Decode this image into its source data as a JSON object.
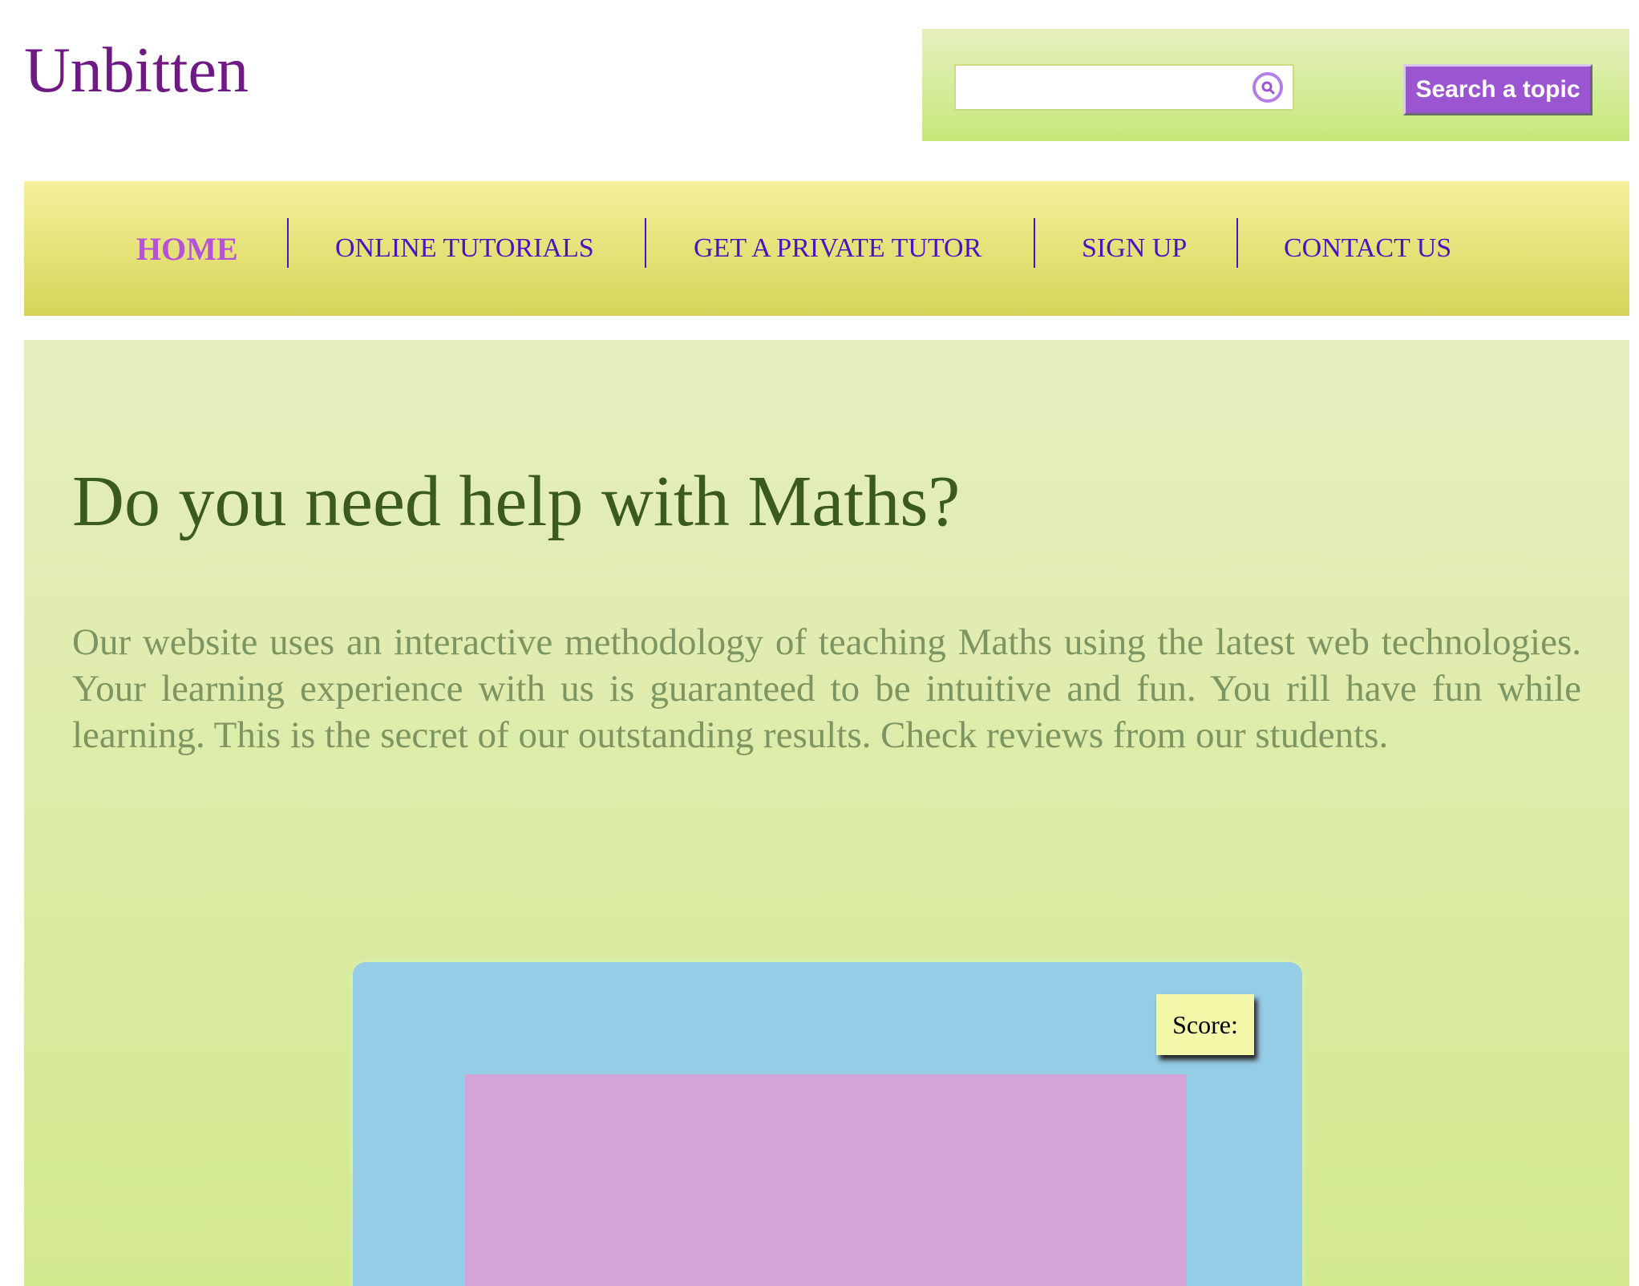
{
  "site": {
    "logo": "Unbitten"
  },
  "search": {
    "value": "",
    "placeholder": "",
    "button_label": "Search a topic"
  },
  "nav": {
    "items": [
      {
        "label": "HOME",
        "active": true
      },
      {
        "label": "ONLINE TUTORIALS",
        "active": false
      },
      {
        "label": "GET A PRIVATE TUTOR",
        "active": false
      },
      {
        "label": "SIGN UP",
        "active": false
      },
      {
        "label": "CONTACT US",
        "active": false
      }
    ]
  },
  "main": {
    "headline": "Do you need help with Maths?",
    "intro": "Our website uses an interactive methodology of teaching Maths using the latest web technologies. Your learning experience with us is guaranteed to be intuitive and fun. You rill have fun while learning. This is the secret of our outstanding results. Check reviews from our students."
  },
  "game": {
    "score_label": "Score:"
  },
  "colors": {
    "logo": "#6f1a84",
    "nav_link": "#4b14c3",
    "nav_active": "#b553d8",
    "search_button": "#9b55d0",
    "headline": "#3b5a1d",
    "intro_text": "#7d9560",
    "game_panel": "#95cce6",
    "game_area": "#d3a4d8",
    "score_box": "#f3f7a8"
  },
  "icons": {
    "search": "search-icon"
  }
}
